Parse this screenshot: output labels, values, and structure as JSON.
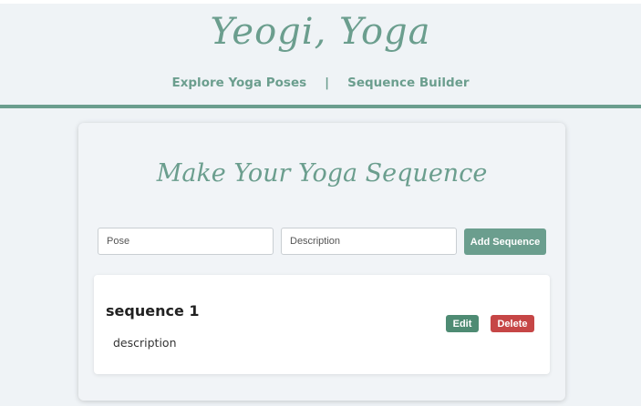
{
  "header": {
    "brand": "Yeogi, Yoga",
    "nav": {
      "explore": "Explore Yoga Poses",
      "separator": "|",
      "builder": "Sequence Builder"
    }
  },
  "builder": {
    "title": "Make Your Yoga Sequence",
    "pose_placeholder": "Pose",
    "description_placeholder": "Description",
    "add_button": "Add Sequence"
  },
  "sequences": [
    {
      "name": "sequence 1",
      "description": "description",
      "edit_label": "Edit",
      "delete_label": "Delete"
    }
  ],
  "colors": {
    "accent": "#6b9e8e",
    "edit": "#4e8b73",
    "delete": "#c64646",
    "background": "#eff3f6"
  }
}
